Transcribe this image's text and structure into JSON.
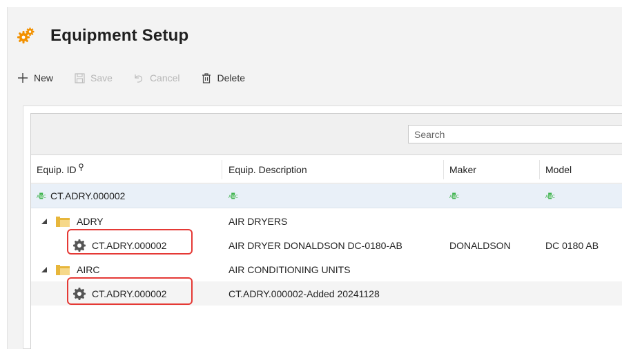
{
  "header": {
    "title": "Equipment Setup"
  },
  "toolbar": {
    "new_label": "New",
    "save_label": "Save",
    "cancel_label": "Cancel",
    "delete_label": "Delete"
  },
  "grid": {
    "search": {
      "placeholder": "Search"
    },
    "columns": [
      "Equip. ID",
      "Equip. Description",
      "Maker",
      "Model"
    ],
    "filter_row": {
      "equip_id": "CT.ADRY.000002"
    },
    "rows": [
      {
        "type": "group",
        "id": "ADRY",
        "description": "AIR DRYERS",
        "maker": "",
        "model": ""
      },
      {
        "type": "item",
        "id": "CT.ADRY.000002",
        "description": "AIR DRYER DONALDSON DC-0180-AB",
        "maker": "DONALDSON",
        "model": "DC 0180 AB",
        "highlighted": true
      },
      {
        "type": "group",
        "id": "AIRC",
        "description": "AIR CONDITIONING UNITS",
        "maker": "",
        "model": ""
      },
      {
        "type": "item",
        "id": "CT.ADRY.000002",
        "description": "CT.ADRY.000002-Added 20241128",
        "maker": "",
        "model": "",
        "highlighted": true,
        "selected": true
      }
    ]
  },
  "colors": {
    "accent_orange": "#f29100",
    "highlight_red": "#e53935",
    "abc_green": "#3fb34f",
    "folder_gold": "#e7b63b"
  },
  "icons": [
    "gears-icon",
    "plus-icon",
    "save-icon",
    "undo-icon",
    "trash-icon",
    "pin-icon",
    "abc-filter-icon",
    "expander-icon",
    "folder-icon",
    "gear-icon"
  ]
}
